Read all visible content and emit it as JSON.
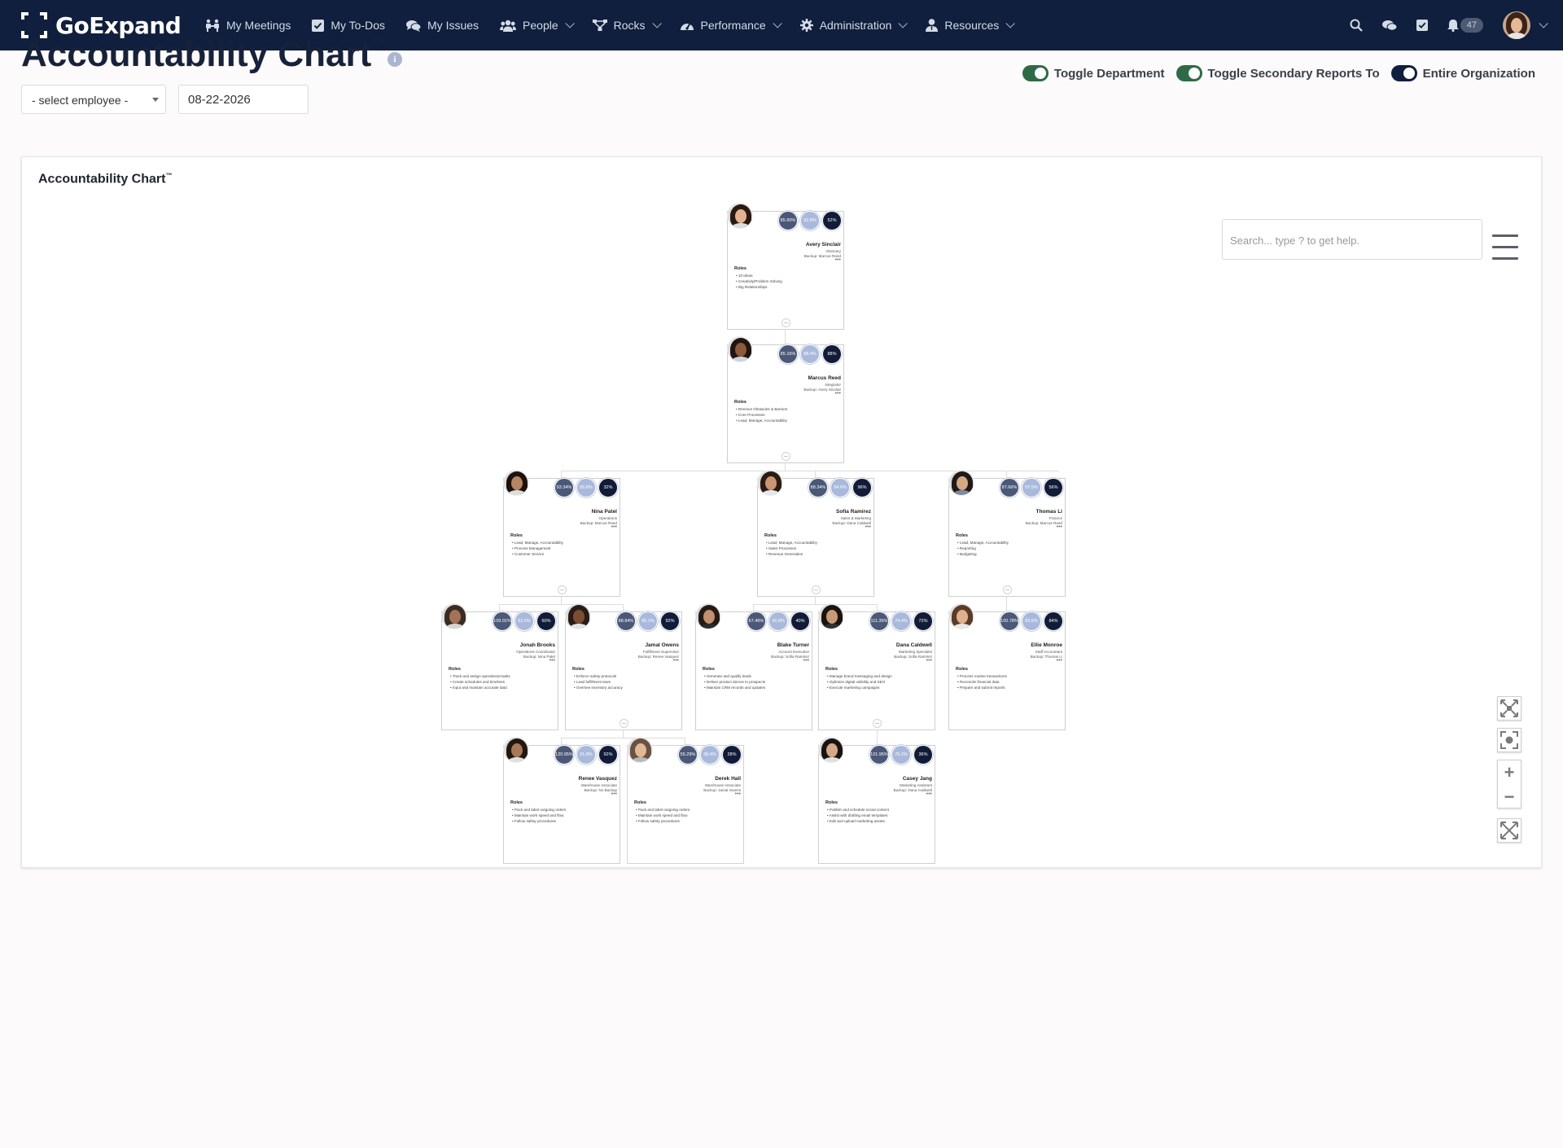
{
  "app": {
    "name": "GoExpand"
  },
  "nav": {
    "items": [
      {
        "label": "My Meetings",
        "icon": "meetings-icon",
        "dropdown": false
      },
      {
        "label": "My To-Dos",
        "icon": "checkbox-icon",
        "dropdown": false
      },
      {
        "label": "My Issues",
        "icon": "chat-bubbles-icon",
        "dropdown": false
      },
      {
        "label": "People",
        "icon": "users-icon",
        "dropdown": true
      },
      {
        "label": "Rocks",
        "icon": "sitemap-icon",
        "dropdown": true
      },
      {
        "label": "Performance",
        "icon": "gauge-icon",
        "dropdown": true
      },
      {
        "label": "Administration",
        "icon": "gear-icon",
        "dropdown": true
      },
      {
        "label": "Resources",
        "icon": "user-tie-icon",
        "dropdown": true
      }
    ],
    "notification_count": "47"
  },
  "page": {
    "title": "Accountability Chart",
    "title_mark": "™",
    "employee_select": "- select employee -",
    "date": "08-22-2026",
    "toggles": [
      {
        "label": "Toggle Department",
        "on": true,
        "color": "#2f6a47"
      },
      {
        "label": "Toggle Secondary Reports To",
        "on": true,
        "color": "#2f6a47"
      },
      {
        "label": "Entire Organization",
        "on": true,
        "color": "#0f1f3d"
      }
    ]
  },
  "chart_panel": {
    "title": "Accountability Chart",
    "title_mark": "™",
    "search_placeholder": "Search... type ? to get help."
  },
  "org": {
    "roles_label": "Roles",
    "people": [
      {
        "name": "Avery Sinclair",
        "title": "Visionary",
        "backup": "Backup: Marcus Reed",
        "metrics": [
          "85.60%",
          "92.8%",
          "52%"
        ],
        "roles": [
          "10 Ideas",
          "Creativity/Problem Solving",
          "Big Relationships"
        ]
      },
      {
        "name": "Marcus Reed",
        "title": "Integrator",
        "backup": "Backup: Avery Sinclair",
        "metrics": [
          "85.16%",
          "88.4%",
          "88%"
        ],
        "roles": [
          "Remove Obstacles & Barriers",
          "Core Processes",
          "Lead, Manage, Accountability"
        ]
      },
      {
        "name": "Nina Patel",
        "title": "Operations",
        "backup": "Backup: Marcus Reed",
        "metrics": [
          "93.34%",
          "95.6%",
          "32%"
        ],
        "roles": [
          "Lead, Manage, Accountability",
          "Process Management",
          "Customer Service"
        ]
      },
      {
        "name": "Sofia Ramirez",
        "title": "Sales & Marketing",
        "backup": "Backup: Dana Caldwell",
        "metrics": [
          "88.34%",
          "94.6%",
          "96%"
        ],
        "roles": [
          "Lead, Manage, Accountability",
          "Sales Processes",
          "Revenue Generation"
        ]
      },
      {
        "name": "Thomas Li",
        "title": "Finance",
        "backup": "Backup: Marcus Reed",
        "metrics": [
          "87.66%",
          "57.5%",
          "56%"
        ],
        "roles": [
          "Lead, Manage, Accountability",
          "Reporting",
          "Budgeting"
        ]
      },
      {
        "name": "Jonah Brooks",
        "title": "Operations Coordinator",
        "backup": "Backup: Nina Patel",
        "metrics": [
          "109.01%",
          "62.5%",
          "60%"
        ],
        "roles": [
          "Track and assign operational tasks",
          "Create schedules and timelines",
          "Input and maintain accurate data"
        ]
      },
      {
        "name": "Jamal Owens",
        "title": "Fulfillment Supervisor",
        "backup": "Backup: Renee Vasquez",
        "metrics": [
          "88.84%",
          "85.1%",
          "92%"
        ],
        "roles": [
          "Enforce safety protocols",
          "Lead fulfillment team",
          "Oversee inventory accuracy"
        ]
      },
      {
        "name": "Blake Turner",
        "title": "Account Executive",
        "backup": "Backup: Sofia Ramirez",
        "metrics": [
          "67.46%",
          "42.8%",
          "40%"
        ],
        "roles": [
          "Generate and qualify leads",
          "Deliver product demos to prospects",
          "Maintain CRM records and updates"
        ]
      },
      {
        "name": "Dana Caldwell",
        "title": "Marketing Specialist",
        "backup": "Backup: Sofia Ramirez",
        "metrics": [
          "111.35%",
          "74.4%",
          "72%"
        ],
        "roles": [
          "Manage brand messaging and design",
          "Optimize digital visibility and SEO",
          "Execute marketing campaigns"
        ]
      },
      {
        "name": "Ellie Monroe",
        "title": "Staff Accountant",
        "backup": "Backup: Thomas Li",
        "metrics": [
          "100.78%",
          "83.6%",
          "84%"
        ],
        "roles": [
          "Process routine transactions",
          "Reconcile financial data",
          "Prepare and submit reports"
        ]
      },
      {
        "name": "Renee Vasquez",
        "title": "Warehouse Associate",
        "backup": "Backup: No Backup",
        "metrics": [
          "120.95%",
          "91.8%",
          "92%"
        ],
        "roles": [
          "Pack and label outgoing orders",
          "Maintain work speed and flow",
          "Follow safety procedures"
        ]
      },
      {
        "name": "Derek Hall",
        "title": "Warehouse Associate",
        "backup": "Backup: Jamal Owens",
        "metrics": [
          "55.29%",
          "38.4%",
          "28%"
        ],
        "roles": [
          "Pack and label outgoing orders",
          "Maintain work speed and flow",
          "Follow safety procedures"
        ]
      },
      {
        "name": "Casey Jang",
        "title": "Marketing Assistant",
        "backup": "Backup: Dana Caldwell",
        "metrics": [
          "101.95%",
          "76.2%",
          "36%"
        ],
        "roles": [
          "Publish and schedule social content",
          "Assist with drafting email templates",
          "Edit and upload marketing assets"
        ]
      }
    ]
  },
  "colors": {
    "navbar": "#0f1f3d",
    "metric_1": "#4b5877",
    "metric_2": "#a9b9db",
    "metric_3": "#121c38",
    "toggle_on_green": "#2f6a47"
  }
}
